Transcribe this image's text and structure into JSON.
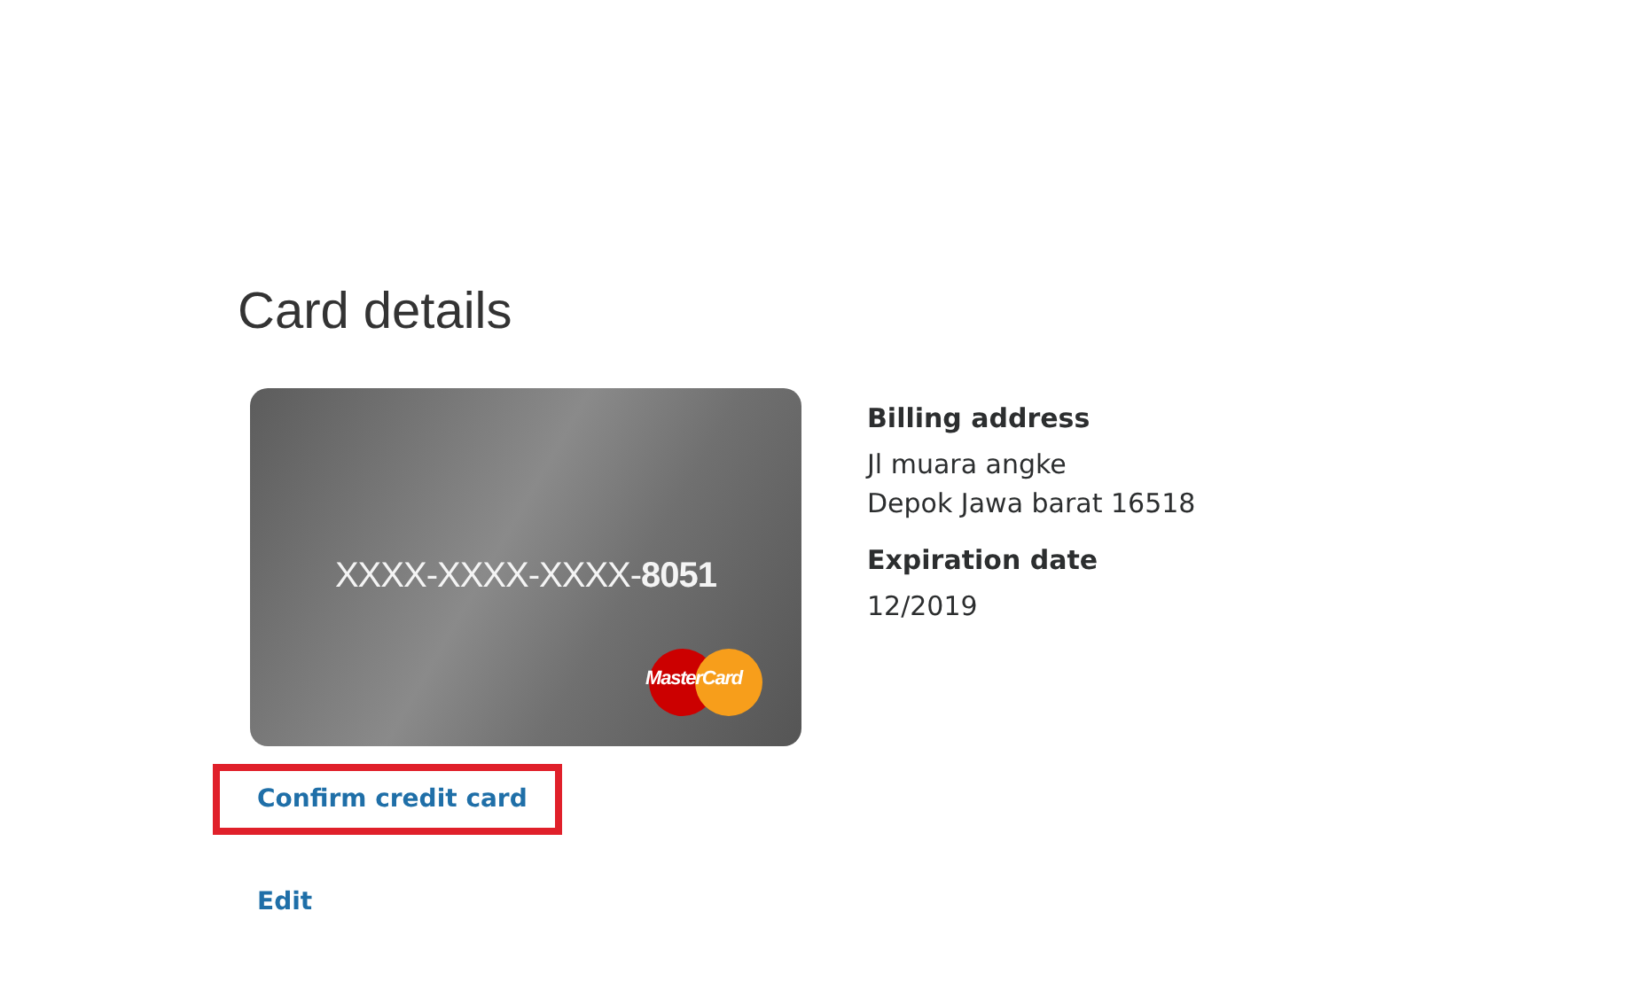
{
  "title": "Card details",
  "card": {
    "number": "XXXX-XXXX-XXXX-**8051**",
    "brand": "MasterCard"
  },
  "details": [
    {
      "label": "Billing address",
      "lines": [
        "Jl muara angke",
        "Depok Jawa barat 16518"
      ]
    },
    {
      "label": "Expiration date",
      "lines": [
        "12/2019"
      ]
    }
  ],
  "links": [
    {
      "label": "Confirm credit card",
      "highlighted": true
    },
    {
      "label": "Edit",
      "highlighted": false
    }
  ]
}
